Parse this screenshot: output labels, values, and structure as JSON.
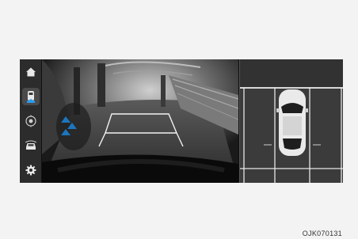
{
  "screen": {
    "camera_warning": "",
    "side_menu": [
      {
        "icon": "home-icon",
        "active": false
      },
      {
        "icon": "rear-view-icon",
        "active": true
      },
      {
        "icon": "sensor-view-icon",
        "active": false
      },
      {
        "icon": "vehicle-view-icon",
        "active": false
      },
      {
        "icon": "settings-icon",
        "active": false
      }
    ],
    "colors": {
      "guide_line": "#f2f2f2",
      "sensor_warning": "#1a7fd0",
      "menu_bg": "#2c2c2c",
      "topview_bg": "#3b3b3b"
    }
  },
  "figure_code": "OJK070131"
}
